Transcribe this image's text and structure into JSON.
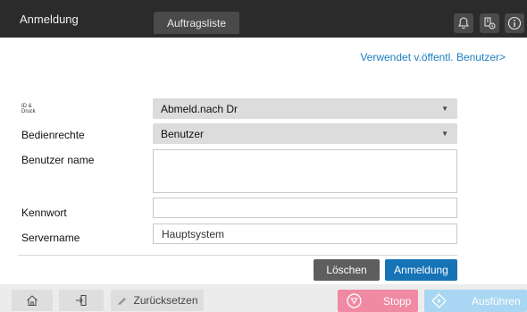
{
  "header": {
    "login_tab": "Anmeldung",
    "jobs_tab": "Auftragsliste",
    "icons": [
      "bell-icon",
      "device-status-icon",
      "info-icon"
    ]
  },
  "public_user_link": "Verwendet v.öffentl. Benutzer>",
  "form": {
    "auth_label_line1": "ID &",
    "auth_label_line2": "Druck",
    "auth_value": "Abmeld.nach Dr",
    "rights_label": "Bedienrechte",
    "rights_value": "Benutzer",
    "username_label": "Benutzer name",
    "username_value": "",
    "password_label": "Kennwort",
    "password_value": "",
    "server_label": "Servername",
    "server_value": "Hauptsystem"
  },
  "buttons": {
    "delete": "Löschen",
    "login": "Anmeldung"
  },
  "bottom": {
    "reset": "Zurücksetzen",
    "stop": "Stopp",
    "start": "Ausführen",
    "icons": [
      "home-icon",
      "logout-icon",
      "eraser-icon",
      "stop-icon",
      "start-icon"
    ]
  },
  "colors": {
    "topbar": "#2b2b2b",
    "link": "#1b7fc1",
    "login_button": "#1673b6",
    "stop_button": "#ef8aa2",
    "start_button": "#a9d6f2"
  }
}
